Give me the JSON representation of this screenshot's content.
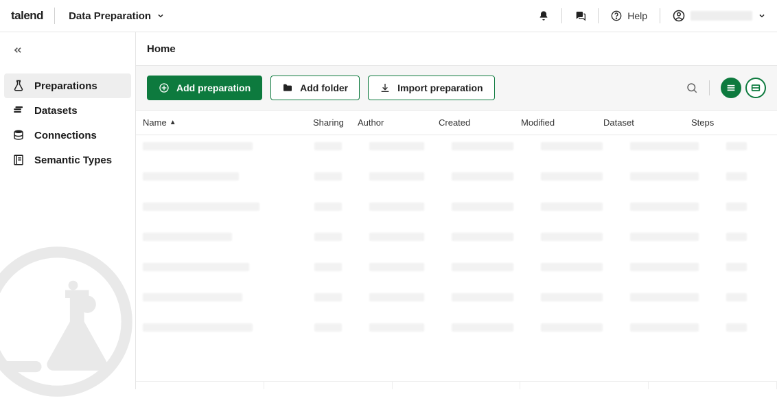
{
  "header": {
    "brand": "talend",
    "app": "Data Preparation",
    "help": "Help"
  },
  "sidebar": {
    "items": [
      {
        "label": "Preparations",
        "icon": "flask"
      },
      {
        "label": "Datasets",
        "icon": "database-small"
      },
      {
        "label": "Connections",
        "icon": "stack"
      },
      {
        "label": "Semantic Types",
        "icon": "book"
      }
    ]
  },
  "breadcrumb": "Home",
  "toolbar": {
    "add_prep": "Add preparation",
    "add_folder": "Add folder",
    "import_prep": "Import preparation"
  },
  "table": {
    "cols": {
      "name": "Name",
      "sharing": "Sharing",
      "author": "Author",
      "created": "Created",
      "modified": "Modified",
      "dataset": "Dataset",
      "steps": "Steps"
    }
  }
}
